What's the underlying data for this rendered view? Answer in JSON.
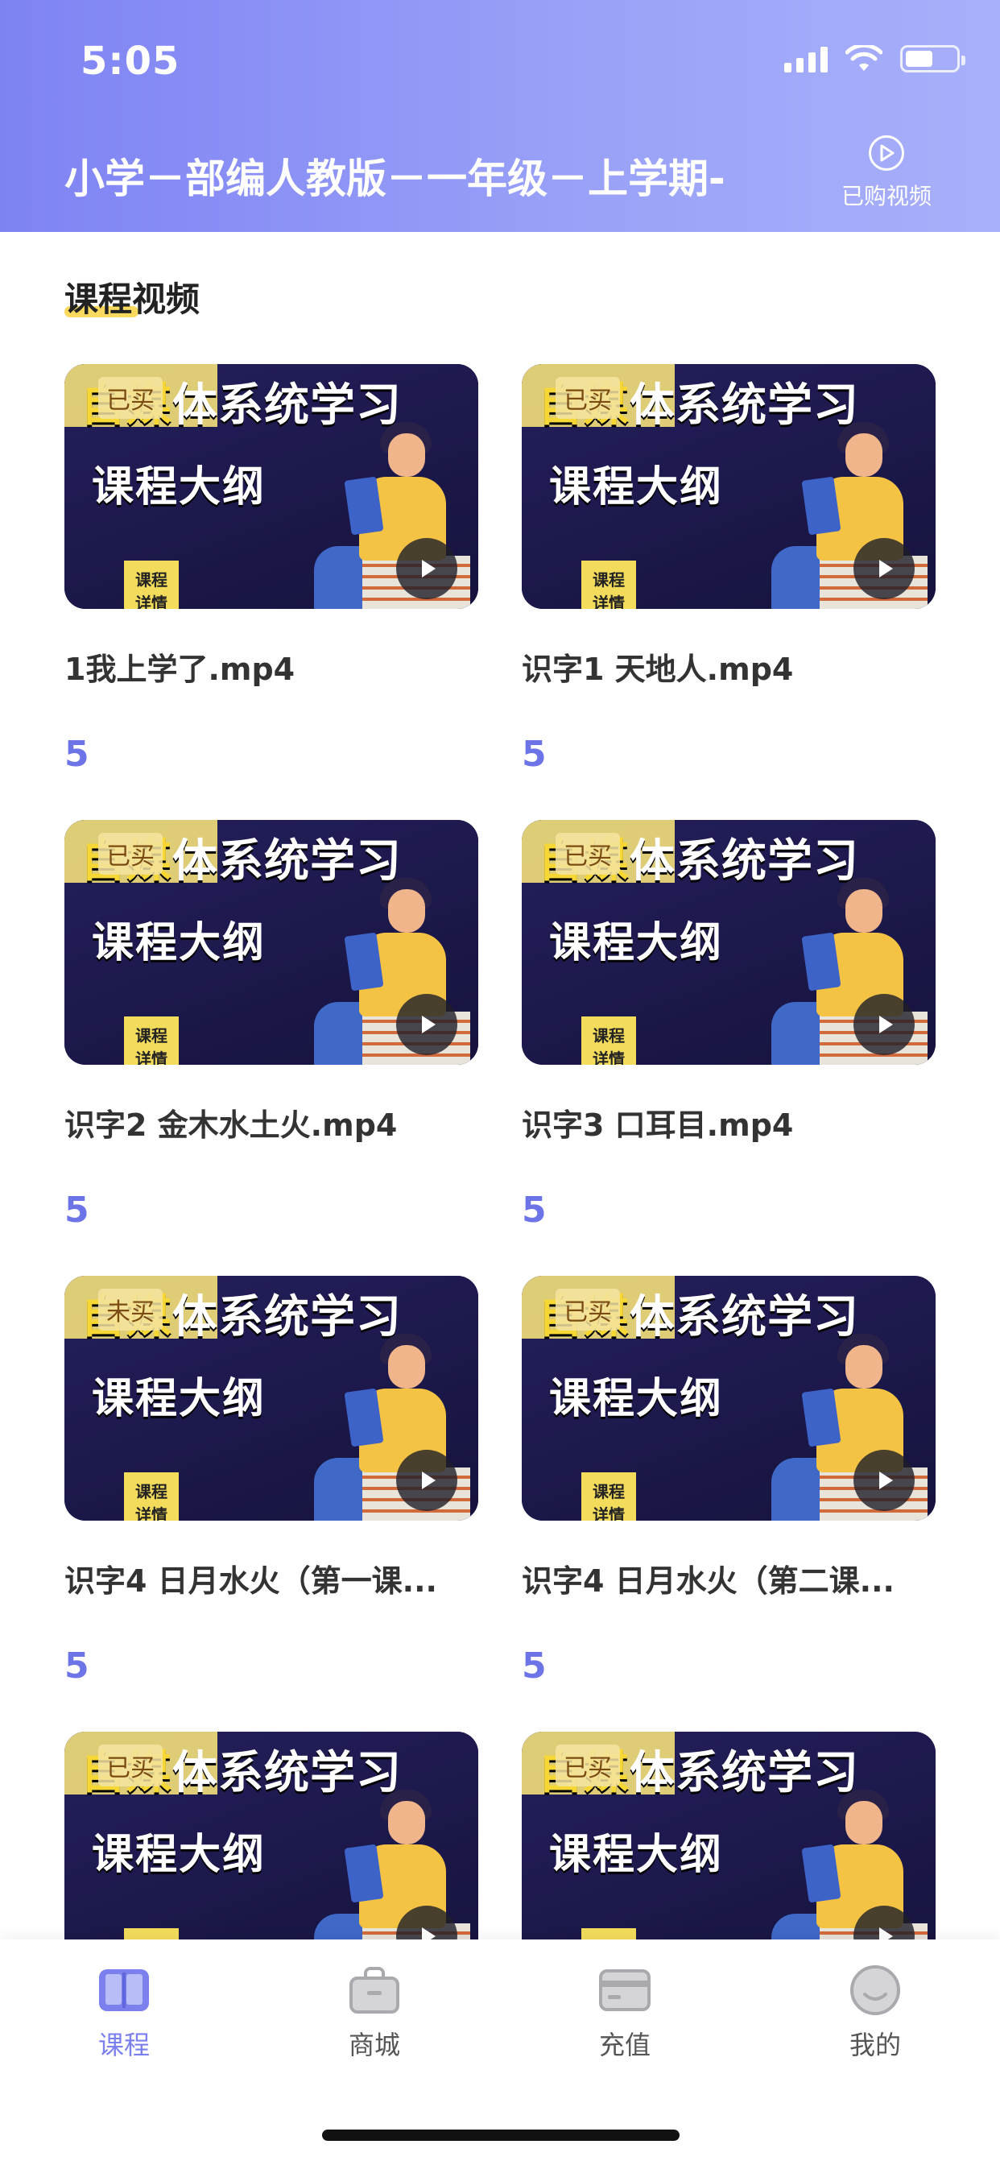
{
  "status_bar": {
    "time": "5:05"
  },
  "header": {
    "title": "小学－部编人教版－一年级－上学期-",
    "purchased_label": "已购视频"
  },
  "section": {
    "title": "课程视频"
  },
  "thumbnail": {
    "banner_first": "自媒",
    "banner_rest": "体系统学习",
    "subtitle": "课程大纲",
    "tag_line1": "课程",
    "tag_line2": "详情"
  },
  "videos": [
    {
      "title": "1我上学了.mp4",
      "count": "5",
      "status": "已买"
    },
    {
      "title": "识字1 天地人.mp4",
      "count": "5",
      "status": "已买"
    },
    {
      "title": "识字2 金木水土火.mp4",
      "count": "5",
      "status": "已买"
    },
    {
      "title": "识字3 口耳目.mp4",
      "count": "5",
      "status": "已买"
    },
    {
      "title": "识字4 日月水火（第一课...",
      "count": "5",
      "status": "未买"
    },
    {
      "title": "识字4 日月水火（第二课...",
      "count": "5",
      "status": "已买"
    },
    {
      "title": "",
      "count": "",
      "status": "已买"
    },
    {
      "title": "",
      "count": "",
      "status": "已买"
    }
  ],
  "tabs": [
    {
      "label": "课程",
      "icon": "book-icon",
      "active": true
    },
    {
      "label": "商城",
      "icon": "bag-icon",
      "active": false
    },
    {
      "label": "充值",
      "icon": "card-icon",
      "active": false
    },
    {
      "label": "我的",
      "icon": "smile-icon",
      "active": false
    }
  ],
  "colors": {
    "accent": "#7b80ee",
    "header_start": "#7e83f3",
    "header_end": "#a8b0fb"
  }
}
